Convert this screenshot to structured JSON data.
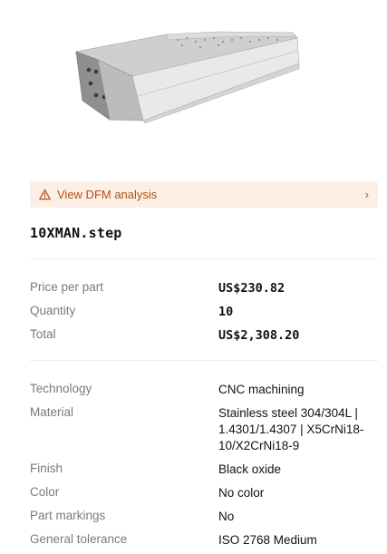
{
  "dfm_banner": {
    "label": "View DFM analysis",
    "icon": "warning-triangle-icon",
    "chevron": "›",
    "accent_color": "#b84c0c",
    "background_color": "#fcf0e6"
  },
  "part": {
    "file_name": "10XMAN.step"
  },
  "pricing": [
    {
      "label": "Price per part",
      "value": "US$230.82"
    },
    {
      "label": "Quantity",
      "value": "10"
    },
    {
      "label": "Total",
      "value": "US$2,308.20"
    }
  ],
  "specs": [
    {
      "label": "Technology",
      "value": "CNC machining"
    },
    {
      "label": "Material",
      "value": "Stainless steel 304/304L | 1.4301/1.4307 | X5CrNi18-10/X2CrNi18-9"
    },
    {
      "label": "Finish",
      "value": "Black oxide"
    },
    {
      "label": "Color",
      "value": "No color"
    },
    {
      "label": "Part markings",
      "value": "No"
    },
    {
      "label": "General tolerance",
      "value": "ISO 2768 Medium"
    }
  ]
}
